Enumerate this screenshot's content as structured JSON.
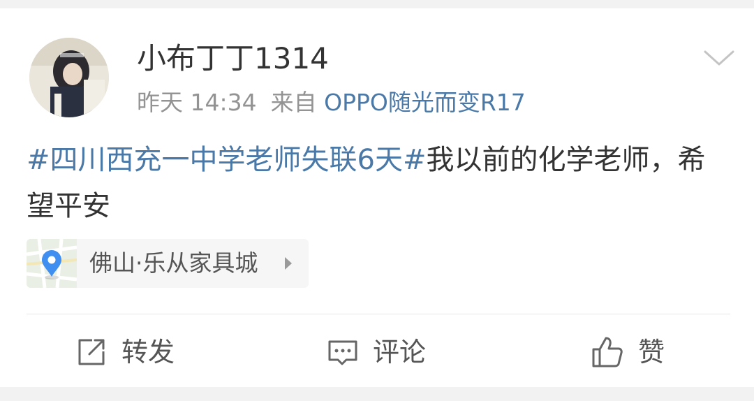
{
  "post": {
    "username": "小布丁丁1314",
    "time": "昨天 14:34",
    "source_prefix": "来自",
    "source_device": "OPPO随光而变R17",
    "topic": "#四川西充一中学老师失联6天#",
    "body": "我以前的化学老师，希望平安",
    "location": "佛山·乐从家具城"
  },
  "actions": {
    "forward_label": "转发",
    "comment_label": "评论",
    "like_label": "赞"
  },
  "icons": {
    "menu": "chevron-down-icon",
    "location": "map-pin-icon",
    "forward": "share-box-icon",
    "comment": "comment-bubble-icon",
    "like": "thumbs-up-icon"
  },
  "colors": {
    "link": "#4a79a8",
    "text": "#333333",
    "meta": "#939393",
    "pin": "#3f8ef0"
  }
}
